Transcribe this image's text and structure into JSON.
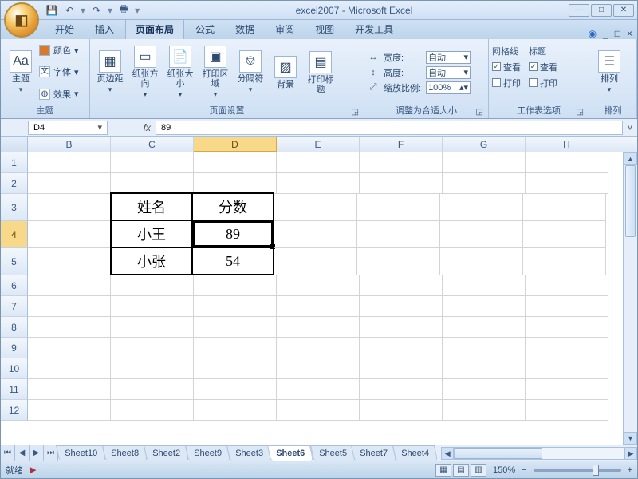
{
  "title": "excel2007 - Microsoft Excel",
  "qat": {
    "tip1": "保存",
    "tip2": "撤消",
    "tip3": "恢复",
    "tip4": "打印"
  },
  "win": {
    "min": "—",
    "max": "□",
    "close": "✕"
  },
  "tabs": {
    "home": "开始",
    "insert": "插入",
    "layout": "页面布局",
    "formulas": "公式",
    "data": "数据",
    "review": "审阅",
    "view": "视图",
    "dev": "开发工具"
  },
  "ribbon": {
    "themes": {
      "label": "主题",
      "themeBtn": "主题",
      "colors": "颜色",
      "fonts": "字体",
      "effects": "效果"
    },
    "pageSetup": {
      "label": "页面设置",
      "margins": "页边距",
      "orientation": "纸张方向",
      "size": "纸张大小",
      "printArea": "打印区域",
      "breaks": "分隔符",
      "background": "背景",
      "titles": "打印标题"
    },
    "scale": {
      "label": "调整为合适大小",
      "widthLbl": "宽度:",
      "widthVal": "自动",
      "heightLbl": "高度:",
      "heightVal": "自动",
      "scaleLbl": "缩放比例:",
      "scaleVal": "100%"
    },
    "sheetOpts": {
      "label": "工作表选项",
      "gridlines": "网格线",
      "headings": "标题",
      "view": "查看",
      "print": "打印"
    },
    "arrange": {
      "label": "排列",
      "btn": "排列"
    }
  },
  "nameBox": "D4",
  "formula": "89",
  "columns": [
    "B",
    "C",
    "D",
    "E",
    "F",
    "G",
    "H"
  ],
  "activeCol": "D",
  "rows": [
    "1",
    "2",
    "3",
    "4",
    "5",
    "6",
    "7",
    "8",
    "9",
    "10",
    "11",
    "12"
  ],
  "activeRow": "4",
  "tableData": {
    "c3": "姓名",
    "d3": "分数",
    "c4": "小王",
    "d4": "89",
    "c5": "小张",
    "d5": "54"
  },
  "sheetTabs": [
    "Sheet10",
    "Sheet8",
    "Sheet2",
    "Sheet9",
    "Sheet3",
    "Sheet6",
    "Sheet5",
    "Sheet7",
    "Sheet4"
  ],
  "activeSheet": "Sheet6",
  "status": {
    "ready": "就绪",
    "zoom": "150%",
    "minus": "−",
    "plus": "+"
  },
  "chart_data": {
    "type": "table",
    "columns": [
      "姓名",
      "分数"
    ],
    "rows": [
      [
        "小王",
        89
      ],
      [
        "小张",
        54
      ]
    ]
  }
}
